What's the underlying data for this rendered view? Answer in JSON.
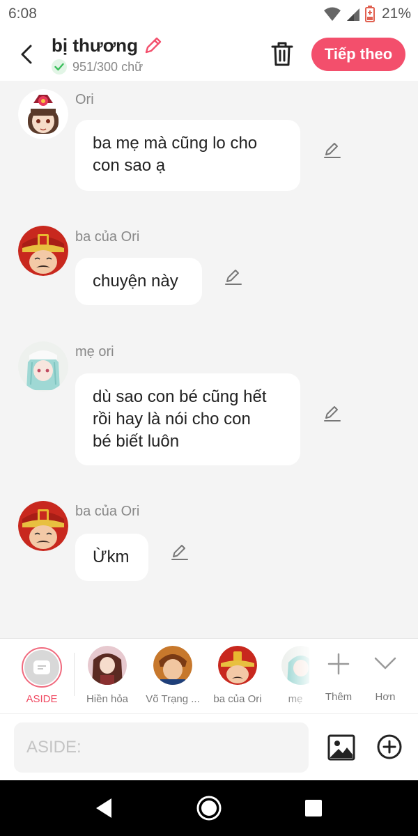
{
  "status_bar": {
    "time": "6:08",
    "battery": "21%"
  },
  "header": {
    "title": "bị thương",
    "word_count": "951/300 chữ",
    "next_label": "Tiếp theo"
  },
  "messages": [
    {
      "sender": "Ori",
      "line1": "ba mẹ mà cũng lo cho",
      "line2": "con sao ạ"
    },
    {
      "sender": "ba của Ori",
      "line1": "chuyện này"
    },
    {
      "sender": "mẹ ori",
      "line1": "dù sao con bé cũng hết",
      "line2": "rồi hay là nói cho con",
      "line3": "bé biết luôn"
    },
    {
      "sender": "ba của Ori",
      "line1": "Ừkm"
    }
  ],
  "characters": {
    "aside": "ASIDE",
    "items": [
      "Hiền hỏa",
      "Võ Trạng ...",
      "ba của Ori",
      "mẹ"
    ],
    "add_label": "Thêm",
    "more_label": "Hơn"
  },
  "input": {
    "placeholder": "ASIDE:"
  },
  "colors": {
    "accent": "#f34f6c",
    "background": "#f4f4f4"
  },
  "icons": [
    "back-arrow-icon",
    "pencil-icon",
    "check-icon",
    "trash-icon",
    "edit-icon",
    "image-icon",
    "add-circle-icon",
    "plus-icon",
    "chevron-down-icon"
  ]
}
